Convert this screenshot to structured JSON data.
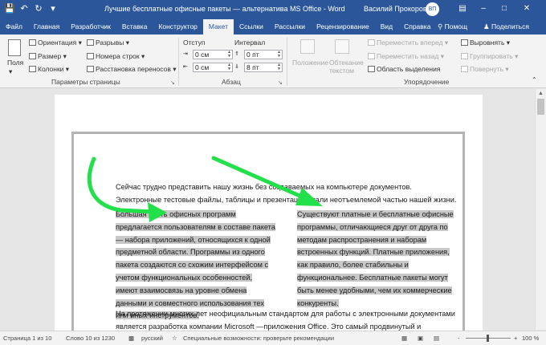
{
  "title_bar": {
    "document_title": "Лучшие бесплатные офисные пакеты — альтернатива MS Office  -  Word",
    "user_name": "Василий Прокоров",
    "user_initials": "ВП",
    "icons": [
      "save-icon",
      "undo-icon",
      "redo-icon",
      "customize-icon",
      "ribbon-display-icon",
      "minimize-icon",
      "maximize-icon",
      "close-icon"
    ]
  },
  "tabs": [
    "Файл",
    "Главная",
    "Разработчик",
    "Вставка",
    "Конструктор",
    "Макет",
    "Ссылки",
    "Рассылки",
    "Рецензирование",
    "Вид",
    "Справка"
  ],
  "active_tab": "Макет",
  "tab_extras": {
    "tell_me": "Помощ",
    "share": "Поделиться"
  },
  "ribbon": {
    "page_setup": {
      "fields_label": "Поля",
      "orientation": "Ориентация",
      "size": "Размер",
      "columns": "Колонки",
      "breaks": "Разрывы",
      "line_numbers": "Номера строк",
      "hyphenation": "Расстановка переносов",
      "group_label": "Параметры страницы"
    },
    "paragraph": {
      "indent_label": "Отступ",
      "spacing_label": "Интервал",
      "indent_left": "0 см",
      "indent_right": "0 см",
      "spacing_before": "0 пт",
      "spacing_after": "8 пт",
      "group_label": "Абзац"
    },
    "arrange": {
      "position": "Положение",
      "wrap_text": "Обтекание текстом",
      "bring_forward": "Переместить вперед",
      "send_backward": "Переместить назад",
      "selection_pane": "Область выделения",
      "align": "Выровнять",
      "group": "Группировать",
      "rotate": "Повернуть",
      "group_label": "Упорядочение"
    }
  },
  "document": {
    "intro_lines": [
      "Сейчас трудно представить нашу жизнь без создаваемых на компьютере документов.",
      "Электронные тестовые файлы, таблицы и презентации стали неотъемлемой частью нашей жизни."
    ],
    "column_left_lines": [
      "Большая часть офисных программ",
      "предлагается пользователям в составе пакета",
      "— набора приложений, относящихся к одной",
      "предметной области. Программы из одного",
      "пакета создаются со схожим интерфейсом с",
      "учетом функциональных особенностей,",
      "имеют взаимосвязь на уровне обмена",
      "данными и совместного использования тех",
      "или иных инструментов."
    ],
    "column_right_lines": [
      "Существуют платные и бесплатные офисные",
      "программы, отличающиеся друг от друга по",
      "методам распространения и наборам",
      "встроенных функций. Платные приложения,",
      "как правило, более стабильны и",
      "функциональнее. Бесплатные пакеты могут",
      "быть менее удобными, чем их коммерческие",
      "конкуренты."
    ],
    "closing_lines": [
      "На протяжении многих лет неофициальным стандартом для работы с электронными документами",
      "является разработка компании Microsoft —приложения Office. Это самый продвинутый и"
    ],
    "annotation_color": "#22e04a"
  },
  "status_bar": {
    "page": "Страница 1 из 10",
    "words": "Слово 10 из 1230",
    "language": "русский",
    "accessibility": "Специальные возможности: проверьте рекомендации",
    "zoom_minus": "-",
    "zoom_plus": "+",
    "zoom": "100 %"
  }
}
